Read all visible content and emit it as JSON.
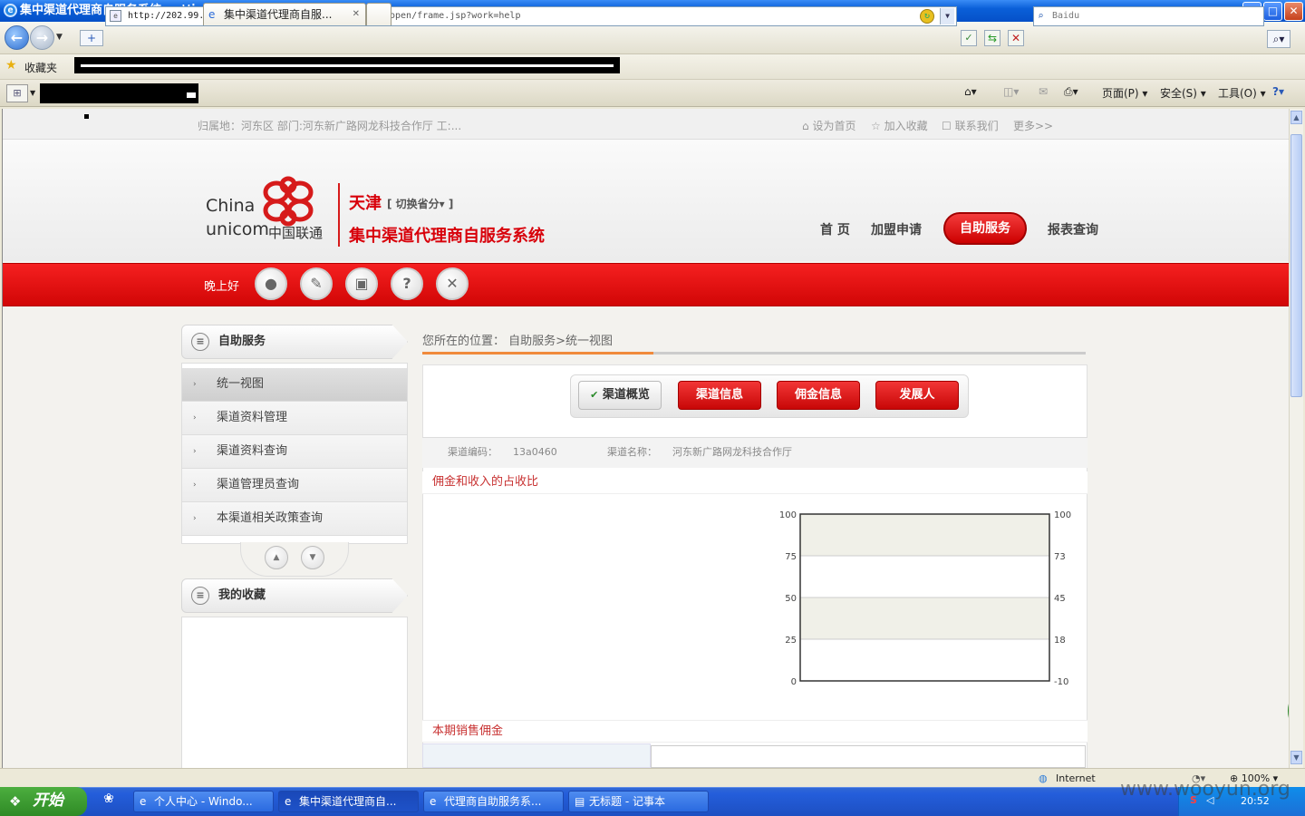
{
  "window": {
    "title": "集中渠道代理商自服务系统 - Windows Internet Explorer",
    "min": "_",
    "max": "□",
    "close": "✕"
  },
  "browser": {
    "url_host": "http://202.99.45.97",
    "url_rest": ":9052/CIS-CHSSF/jsp/internet/open/frame.jsp?work=help",
    "search_placeholder": "Baidu",
    "favorites_label": "收藏夹",
    "tab_label": "集中渠道代理商自服...",
    "tab_close": "✕",
    "tools": [
      "页面(P)",
      "安全(S)",
      "工具(O)"
    ]
  },
  "site": {
    "top_info": "归属地：河东区 部门:河东新广路网龙科技合作厅 工:...",
    "top_links": [
      "设为首页",
      "加入收藏",
      "联系我们",
      "更多>>"
    ],
    "logo_china": "China",
    "logo_unicom": "unicom",
    "logo_cn": "中国联通",
    "province": "天津",
    "switch_province": "[ 切换省分▾ ]",
    "system_name": "集中渠道代理商自服务系统",
    "nav": [
      "首 页",
      "加盟申请",
      "自助服务",
      "报表查询"
    ],
    "greeting": "晚上好"
  },
  "sidebar": {
    "section1": "自助服务",
    "items": [
      "统一视图",
      "渠道资料管理",
      "渠道资料查询",
      "渠道管理员查询",
      "本渠道相关政策查询"
    ],
    "section2": "我的收藏",
    "up": "▲",
    "down": "▼"
  },
  "main": {
    "breadcrumb": "您所在的位置： 自助服务>统一视图",
    "tabs": [
      "渠道概览",
      "渠道信息",
      "佣金信息",
      "发展人"
    ],
    "code_label": "渠道编码：",
    "code_value": "13a0460",
    "name_label": "渠道名称：",
    "name_value": "河东新广路网龙科技合作厅",
    "section_chart": "佣金和收入的占收比",
    "section_sales": "本期销售佣金"
  },
  "chart_data": {
    "type": "line",
    "left_axis_ticks": [
      "100",
      "75",
      "50",
      "25",
      "0"
    ],
    "right_axis_ticks": [
      "100",
      "73",
      "45",
      "18",
      "-10"
    ],
    "ylim_left": [
      0,
      100
    ],
    "ylim_right": [
      -10,
      100
    ],
    "series": [],
    "grid": true
  },
  "statusbar": {
    "zone": "Internet",
    "zoom": "100%"
  },
  "taskbar": {
    "start": "开始",
    "tasks": [
      "个人中心 - Windo...",
      "集中渠道代理商自...",
      "代理商自助服务系...",
      "无标题 - 记事本"
    ],
    "clock": "20:52"
  },
  "watermark": "www.wooyun.org"
}
